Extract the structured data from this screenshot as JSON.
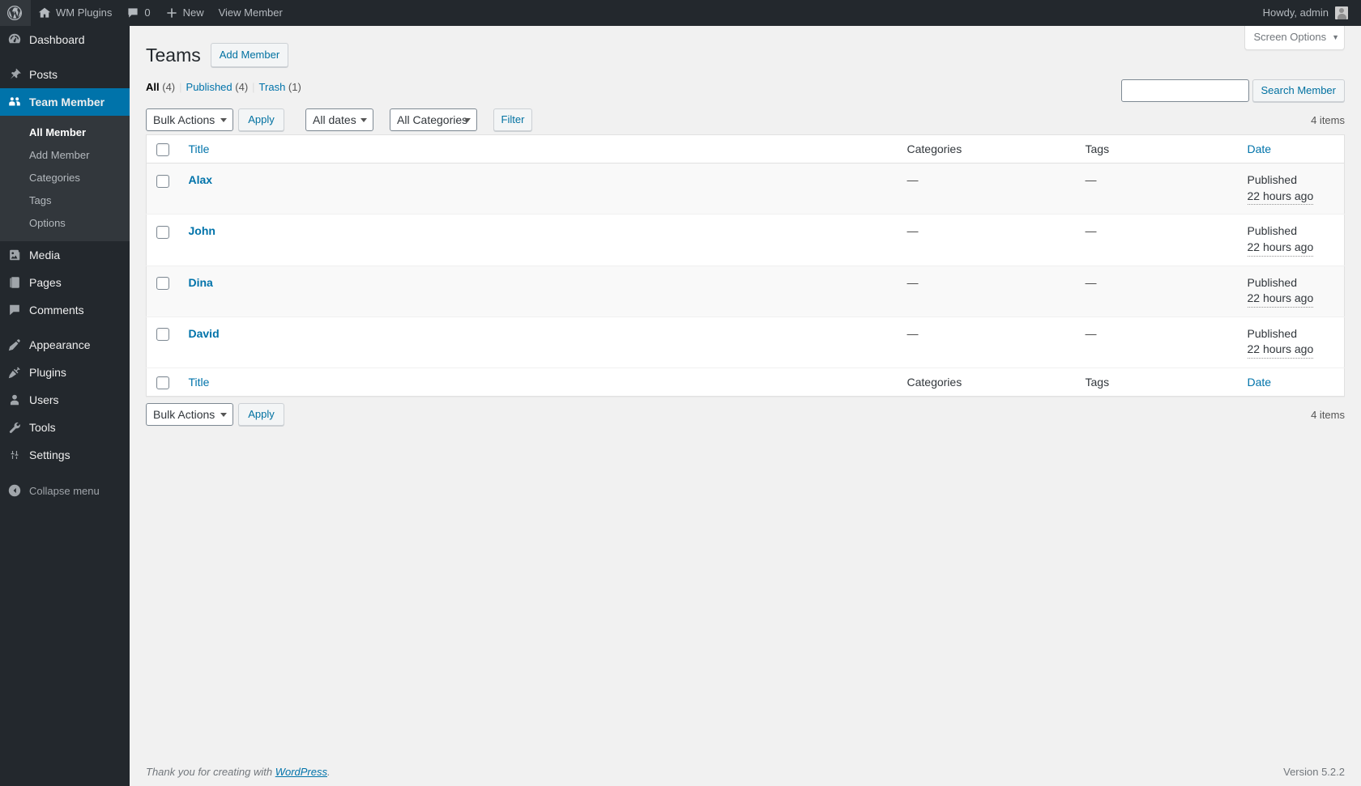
{
  "adminbar": {
    "logo_icon": "wordpress-logo-icon",
    "site": {
      "label": "WM Plugins",
      "icon": "home-icon"
    },
    "comments": {
      "count": "0",
      "icon": "comment-bubble-icon"
    },
    "new": {
      "label": "New",
      "icon": "plus-icon"
    },
    "view": {
      "label": "View Member"
    },
    "howdy": "Howdy, admin",
    "avatar_icon": "user-avatar-icon"
  },
  "sidebar": {
    "items": [
      {
        "label": "Dashboard",
        "icon": "dashboard-icon",
        "key": "dashboard"
      },
      {
        "label": "Posts",
        "icon": "pin-icon",
        "key": "posts"
      },
      {
        "label": "Team Member",
        "icon": "group-icon",
        "key": "team-member",
        "current": true
      },
      {
        "label": "Media",
        "icon": "media-icon",
        "key": "media"
      },
      {
        "label": "Pages",
        "icon": "pages-icon",
        "key": "pages"
      },
      {
        "label": "Comments",
        "icon": "comment-bubble-icon",
        "key": "comments"
      },
      {
        "label": "Appearance",
        "icon": "paintbrush-icon",
        "key": "appearance"
      },
      {
        "label": "Plugins",
        "icon": "plug-icon",
        "key": "plugins"
      },
      {
        "label": "Users",
        "icon": "user-icon",
        "key": "users"
      },
      {
        "label": "Tools",
        "icon": "wrench-icon",
        "key": "tools"
      },
      {
        "label": "Settings",
        "icon": "sliders-icon",
        "key": "settings"
      }
    ],
    "submenu": [
      {
        "label": "All Member",
        "current": true
      },
      {
        "label": "Add Member",
        "current": false
      },
      {
        "label": "Categories",
        "current": false
      },
      {
        "label": "Tags",
        "current": false
      },
      {
        "label": "Options",
        "current": false
      }
    ],
    "collapse": {
      "label": "Collapse menu",
      "icon": "chevron-left-circle-icon"
    }
  },
  "screen_meta": {
    "label": "Screen Options",
    "caret": "▼"
  },
  "header": {
    "title": "Teams",
    "add_action": "Add Member"
  },
  "views": {
    "all": {
      "label": "All",
      "count": "(4)"
    },
    "published": {
      "label": "Published",
      "count": "(4)"
    },
    "trash": {
      "label": "Trash",
      "count": "(1)"
    },
    "divider": "|"
  },
  "search": {
    "value": "",
    "placeholder": "",
    "button": "Search Member"
  },
  "tablenav_top": {
    "bulk_actions": "Bulk Actions",
    "apply": "Apply",
    "dates": "All dates",
    "categories": "All Categories",
    "filter": "Filter",
    "displaying_num": "4 items"
  },
  "tablenav_bottom": {
    "bulk_actions": "Bulk Actions",
    "apply": "Apply",
    "displaying_num": "4 items"
  },
  "table": {
    "columns": {
      "title": "Title",
      "categories": "Categories",
      "tags": "Tags",
      "date": "Date"
    },
    "rows": [
      {
        "title": "Alax",
        "categories": "—",
        "tags": "—",
        "status": "Published",
        "relative": "22 hours ago"
      },
      {
        "title": "John",
        "categories": "—",
        "tags": "—",
        "status": "Published",
        "relative": "22 hours ago"
      },
      {
        "title": "Dina",
        "categories": "—",
        "tags": "—",
        "status": "Published",
        "relative": "22 hours ago"
      },
      {
        "title": "David",
        "categories": "—",
        "tags": "—",
        "status": "Published",
        "relative": "22 hours ago"
      }
    ]
  },
  "footer": {
    "thanks_prefix": "Thank you for creating with ",
    "wordpress_link": "WordPress",
    "thanks_suffix": ".",
    "version": "Version 5.2.2"
  },
  "colors": {
    "admin_bar": "#23282d",
    "sidebar": "#23282d",
    "submenu": "#32373c",
    "current": "#0073aa",
    "link": "#0073aa",
    "page_bg": "#f1f1f1"
  }
}
